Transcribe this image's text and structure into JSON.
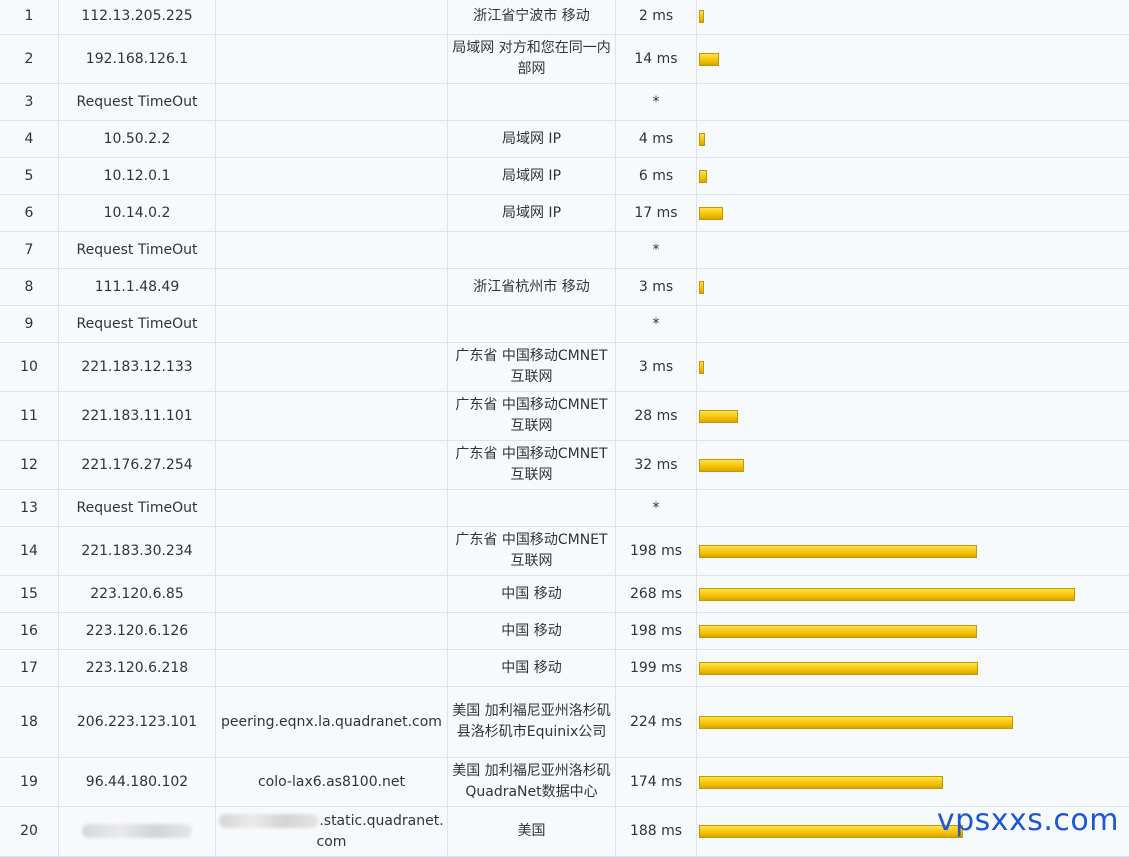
{
  "hops": [
    {
      "no": "1",
      "ip": "112.13.205.225",
      "host": "",
      "location": "浙江省宁波市 移动",
      "time": "2 ms",
      "ms": 2
    },
    {
      "no": "2",
      "ip": "192.168.126.1",
      "host": "",
      "location": "局域网 对方和您在同一内部网",
      "time": "14 ms",
      "ms": 14
    },
    {
      "no": "3",
      "ip": "Request TimeOut",
      "host": "",
      "location": "",
      "time": "*",
      "ms": 0
    },
    {
      "no": "4",
      "ip": "10.50.2.2",
      "host": "",
      "location": "局域网 IP",
      "time": "4 ms",
      "ms": 4
    },
    {
      "no": "5",
      "ip": "10.12.0.1",
      "host": "",
      "location": "局域网 IP",
      "time": "6 ms",
      "ms": 6
    },
    {
      "no": "6",
      "ip": "10.14.0.2",
      "host": "",
      "location": "局域网 IP",
      "time": "17 ms",
      "ms": 17
    },
    {
      "no": "7",
      "ip": "Request TimeOut",
      "host": "",
      "location": "",
      "time": "*",
      "ms": 0
    },
    {
      "no": "8",
      "ip": "111.1.48.49",
      "host": "",
      "location": "浙江省杭州市 移动",
      "time": "3 ms",
      "ms": 3
    },
    {
      "no": "9",
      "ip": "Request TimeOut",
      "host": "",
      "location": "",
      "time": "*",
      "ms": 0
    },
    {
      "no": "10",
      "ip": "221.183.12.133",
      "host": "",
      "location": "广东省 中国移动CMNET互联网",
      "time": "3 ms",
      "ms": 3
    },
    {
      "no": "11",
      "ip": "221.183.11.101",
      "host": "",
      "location": "广东省 中国移动CMNET互联网",
      "time": "28 ms",
      "ms": 28
    },
    {
      "no": "12",
      "ip": "221.176.27.254",
      "host": "",
      "location": "广东省 中国移动CMNET互联网",
      "time": "32 ms",
      "ms": 32
    },
    {
      "no": "13",
      "ip": "Request TimeOut",
      "host": "",
      "location": "",
      "time": "*",
      "ms": 0
    },
    {
      "no": "14",
      "ip": "221.183.30.234",
      "host": "",
      "location": "广东省 中国移动CMNET互联网",
      "time": "198 ms",
      "ms": 198
    },
    {
      "no": "15",
      "ip": "223.120.6.85",
      "host": "",
      "location": "中国 移动",
      "time": "268 ms",
      "ms": 268
    },
    {
      "no": "16",
      "ip": "223.120.6.126",
      "host": "",
      "location": "中国 移动",
      "time": "198 ms",
      "ms": 198
    },
    {
      "no": "17",
      "ip": "223.120.6.218",
      "host": "",
      "location": "中国 移动",
      "time": "199 ms",
      "ms": 199
    },
    {
      "no": "18",
      "ip": "206.223.123.101",
      "host": "peering.eqnx.la.quadranet.com",
      "location": "美国 加利福尼亚州洛杉矶县洛杉矶市Equinix公司",
      "time": "224 ms",
      "ms": 224
    },
    {
      "no": "19",
      "ip": "96.44.180.102",
      "host": "colo-lax6.as8100.net",
      "location": "美国 加利福尼亚州洛杉矶QuadraNet数据中心",
      "time": "174 ms",
      "ms": 174
    },
    {
      "no": "20",
      "ip": "",
      "ip_blurred": true,
      "host": ".static.quadranet.com",
      "host_blurred_prefix": true,
      "location": "美国",
      "time": "188 ms",
      "ms": 188
    }
  ],
  "bar_scale_max_ms": 268,
  "bar_color": "#f4c200",
  "watermark": "vpsxxs.com"
}
